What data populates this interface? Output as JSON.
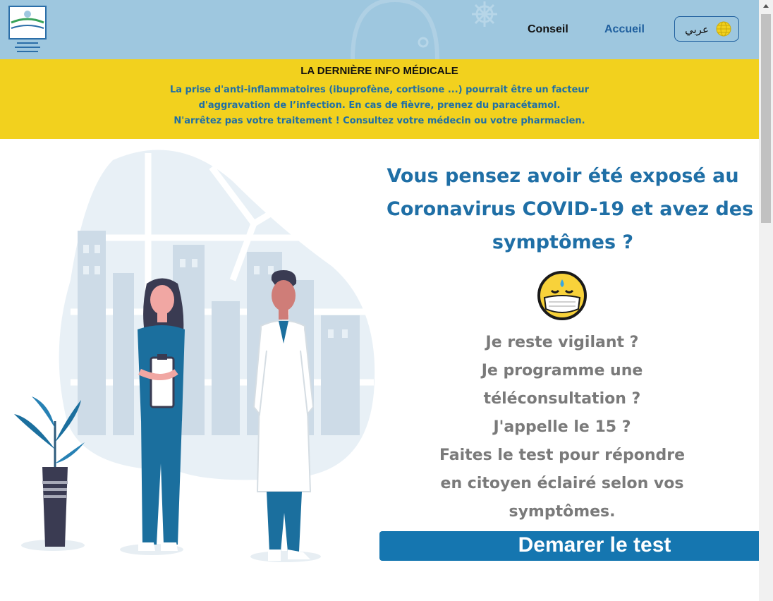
{
  "header": {
    "nav": {
      "conseil": "Conseil",
      "accueil": "Accueil"
    },
    "language_button": "عربي",
    "icons": {
      "logo": "ministry-logo",
      "globe": "globe-icon"
    }
  },
  "banner": {
    "title": "LA DERNIÈRE INFO MÉDICALE",
    "lines": [
      "La prise d'anti-inflammatoires (ibuprofène, cortisone ...) pourrait être un facteur",
      "d'aggravation de l’infection. En cas de fièvre, prenez du paracétamol.",
      "N'arrêtez pas votre traitement ! Consultez votre médecin ou votre pharmacien."
    ]
  },
  "main": {
    "headline": [
      "Vous pensez avoir été exposé au",
      "Coronavirus COVID-19 et avez des",
      "symptômes ?"
    ],
    "questions": [
      "Je reste vigilant ?",
      "Je programme une",
      "téléconsultation ?",
      "J'appelle le 15 ?",
      "Faites le test pour répondre",
      "en citoyen éclairé selon vos",
      "symptômes."
    ],
    "start_button": "Demarer le test"
  },
  "colors": {
    "header_bg": "#9ec7df",
    "banner_bg": "#f2d11e",
    "accent_blue": "#1f6fa6",
    "button_blue": "#1576b0",
    "question_gray": "#7a7a7a"
  }
}
